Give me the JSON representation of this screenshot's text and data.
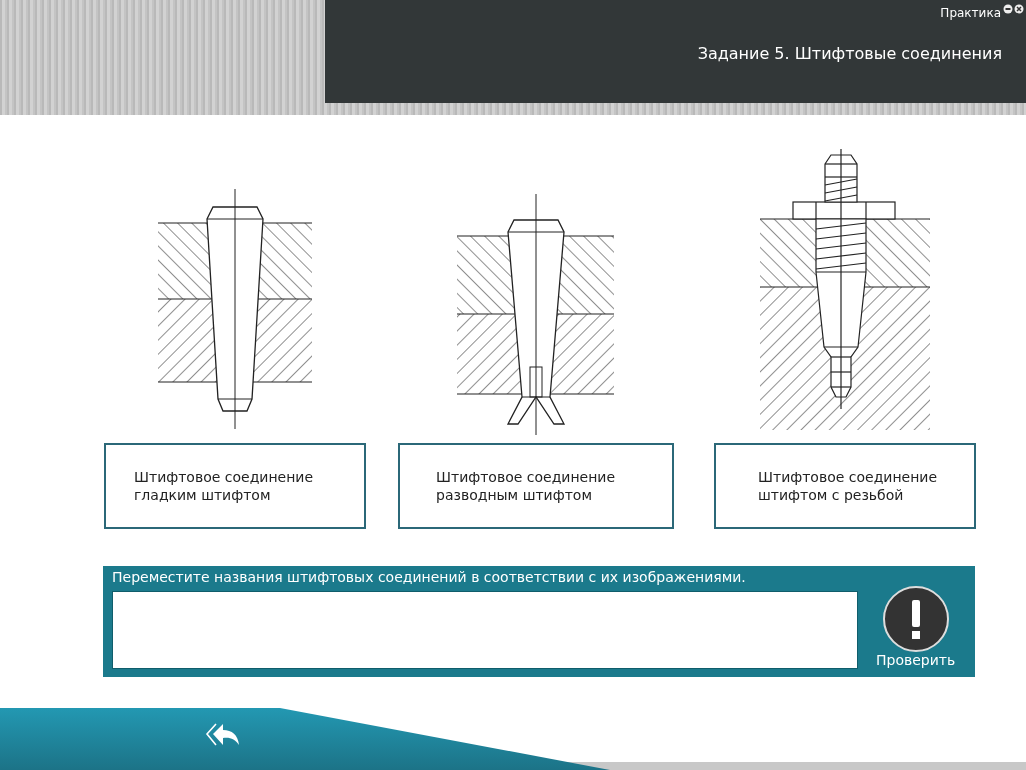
{
  "header": {
    "section": "Практика",
    "title": "Задание 5. Штифтовые соединения"
  },
  "joints": [
    {
      "kind": "smooth",
      "label": "Штифтовое соединение гладким штифтом"
    },
    {
      "kind": "split",
      "label": "Штифтовое соединение разводным штифтом"
    },
    {
      "kind": "threaded",
      "label": "Штифтовое соединение штифтом с резьбой"
    }
  ],
  "task": {
    "instruction": "Переместите названия штифтовых соединений в соответствии с их изображениями.",
    "check_button": "Проверить"
  }
}
